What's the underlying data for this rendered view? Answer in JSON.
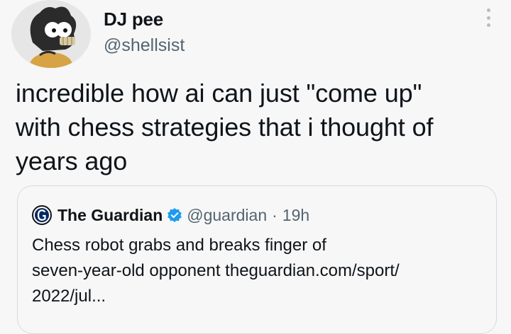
{
  "author": {
    "name": "DJ pee",
    "handle": "@shellsist",
    "avatar_icon": "cartoon-character-avatar-icon"
  },
  "more_icon": "more-options-vertical-dots-icon",
  "tweet": {
    "lines": [
      "incredible how ai can just \"come up\"",
      "with chess strategies that i thought of",
      "years ago"
    ]
  },
  "quote": {
    "logo_icon": "guardian-logo-icon",
    "name": "The Guardian",
    "verified_icon": "verified-badge-icon",
    "handle": "@guardian",
    "separator": "·",
    "time": "19h",
    "lines": [
      "Chess robot grabs and breaks finger of",
      "seven-year-old opponent theguardian.com/sport/",
      "2022/jul..."
    ]
  },
  "colors": {
    "background": "#f7f7f7",
    "text": "#0f1419",
    "secondary_text": "#536471",
    "verified_blue": "#1d9bf0",
    "border": "#d6dbdf"
  }
}
